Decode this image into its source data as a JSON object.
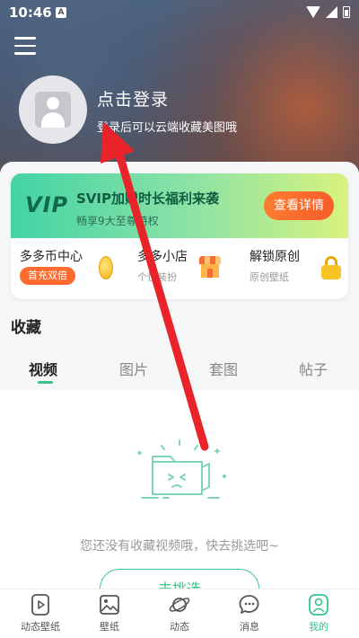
{
  "status": {
    "time": "10:46",
    "notif_letter": "A"
  },
  "header": {
    "login_title": "点击登录",
    "login_subtitle": "登录后可以云端收藏美图哦"
  },
  "vip": {
    "logo": "VIP",
    "title": "SVIP加赠时长福利来袭",
    "subtitle": "畅享9大至尊特权",
    "button": "查看详情"
  },
  "features": [
    {
      "title": "多多币中心",
      "badge": "首充双倍",
      "icon": "coin-icon"
    },
    {
      "title": "多多小店",
      "subtitle": "个性装扮",
      "icon": "shop-icon"
    },
    {
      "title": "解锁原创",
      "subtitle": "原创壁纸",
      "icon": "lock-icon"
    }
  ],
  "collection": {
    "title": "收藏",
    "tabs": [
      "视频",
      "图片",
      "套图",
      "帖子"
    ],
    "active_tab": "视频",
    "empty_text": "您还没有收藏视频哦，快去挑选吧~",
    "go_button": "去挑选"
  },
  "bottom_nav": [
    {
      "label": "动态壁纸",
      "icon": "play-video-icon"
    },
    {
      "label": "壁纸",
      "icon": "image-icon"
    },
    {
      "label": "动态",
      "icon": "planet-icon"
    },
    {
      "label": "消息",
      "icon": "message-bubble-icon"
    },
    {
      "label": "我的",
      "icon": "person-icon",
      "active": true
    }
  ],
  "colors": {
    "accent_green": "#36c48a",
    "vip_button_orange": "#f65c2b",
    "annotation_arrow": "#e8242a"
  }
}
